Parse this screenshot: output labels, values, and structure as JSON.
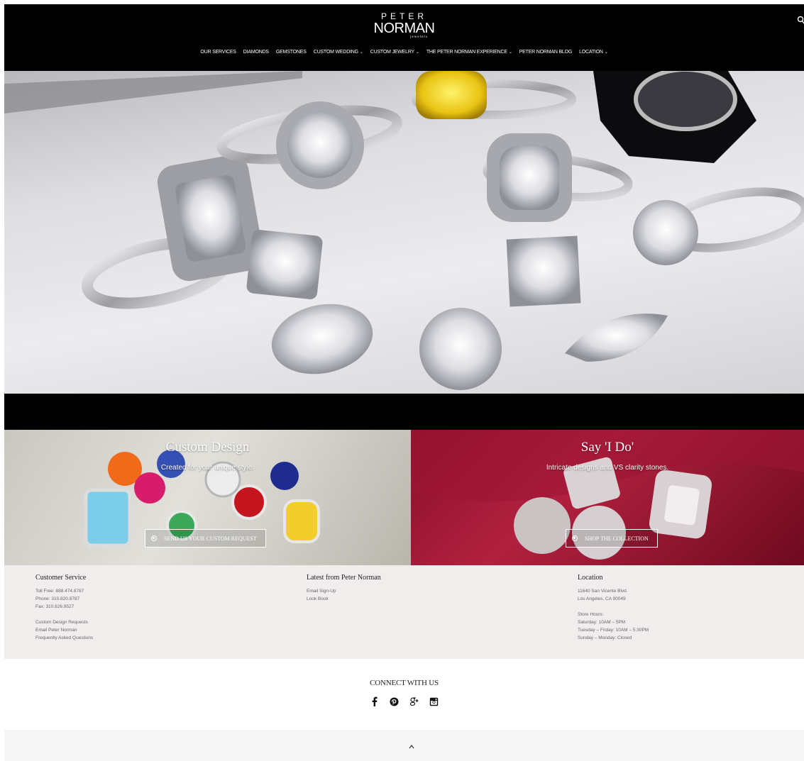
{
  "header": {
    "logo_top": "PETER",
    "logo_main": "NORMAN",
    "logo_sub": "jewelers",
    "nav": [
      {
        "label": "OUR SERVICES",
        "dropdown": false
      },
      {
        "label": "DIAMONDS",
        "dropdown": false
      },
      {
        "label": "GEMSTONES",
        "dropdown": false
      },
      {
        "label": "CUSTOM WEDDING",
        "dropdown": true
      },
      {
        "label": "CUSTOM JEWELRY",
        "dropdown": true
      },
      {
        "label": "THE PETER NORMAN EXPERIENCE",
        "dropdown": true
      },
      {
        "label": "PETER NORMAN BLOG",
        "dropdown": false
      },
      {
        "label": "LOCATION",
        "dropdown": true
      }
    ],
    "chevron": "⌄"
  },
  "promo": {
    "left": {
      "title": "Custom Design",
      "subtitle": "Created for your unique style.",
      "button": "SEND US YOUR CUSTOM REQUEST"
    },
    "right": {
      "title": "Say 'I Do'",
      "subtitle": "Intricate designs and VS clarity stones.",
      "button": "SHOP THE COLLECTION"
    }
  },
  "footer": {
    "customer_service": {
      "heading": "Customer Service",
      "lines": [
        "Toll Free: 888.474.8787",
        "Phone: 310.820.8787",
        "Fax: 310.826.9527"
      ],
      "links": [
        "Custom Design Requests",
        "Email Peter Norman",
        "Frequently Asked Questions"
      ]
    },
    "latest": {
      "heading": "Latest from Peter Norman",
      "links": [
        "Email Sign-Up",
        "Look Book"
      ]
    },
    "location": {
      "heading": "Location",
      "address": [
        "11640 San Vicente Blvd.",
        "Los Angeles, CA 90049"
      ],
      "hours": [
        "Store Hours:",
        "Saturday: 10AM – 5PM",
        "Tuesday – Friday: 10AM – 5:30PM",
        "Sunday – Monday: Closed"
      ]
    }
  },
  "connect": {
    "title": "CONNECT WITH US",
    "icons": [
      "facebook-icon",
      "pinterest-icon",
      "google-plus-icon",
      "instagram-icon"
    ]
  },
  "colors": {
    "accent_red": "#a81a36",
    "header_bg": "#000000",
    "footer_bg": "#f1eded"
  }
}
